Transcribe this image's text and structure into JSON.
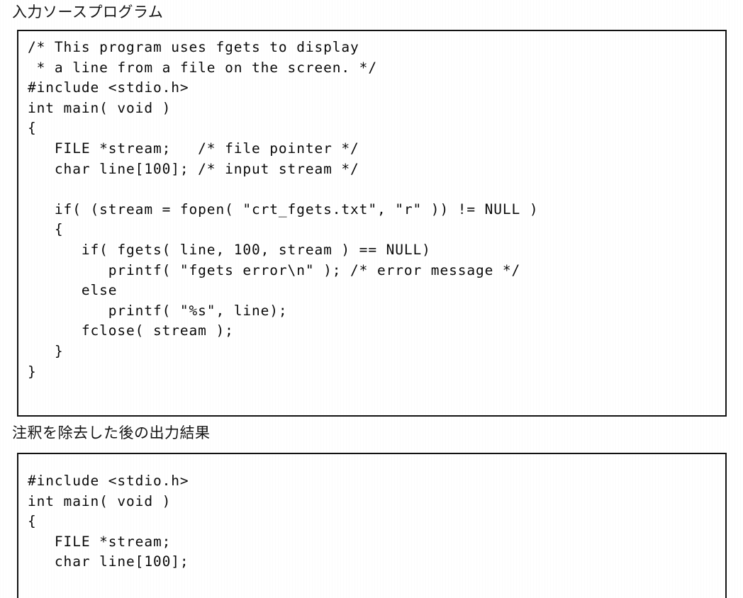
{
  "sections": [
    {
      "caption": "入力ソースプログラム",
      "code_lines": [
        "/* This program uses fgets to display",
        " * a line from a file on the screen. */",
        "#include <stdio.h>",
        "int main( void )",
        "{",
        "   FILE *stream;   /* file pointer */",
        "   char line[100]; /* input stream */",
        "",
        "   if( (stream = fopen( \"crt_fgets.txt\", \"r\" )) != NULL )",
        "   {",
        "      if( fgets( line, 100, stream ) == NULL)",
        "         printf( \"fgets error\\n\" ); /* error message */",
        "      else",
        "         printf( \"%s\", line);",
        "      fclose( stream );",
        "   }",
        "}"
      ]
    },
    {
      "caption": "注釈を除去した後の出力結果",
      "code_lines": [
        "#include <stdio.h>",
        "int main( void )",
        "{",
        "   FILE *stream;",
        "   char line[100];"
      ]
    }
  ],
  "colors": {
    "page_background": "#ffffff",
    "ink": "#0b0b0b",
    "box_border": "#121212"
  }
}
